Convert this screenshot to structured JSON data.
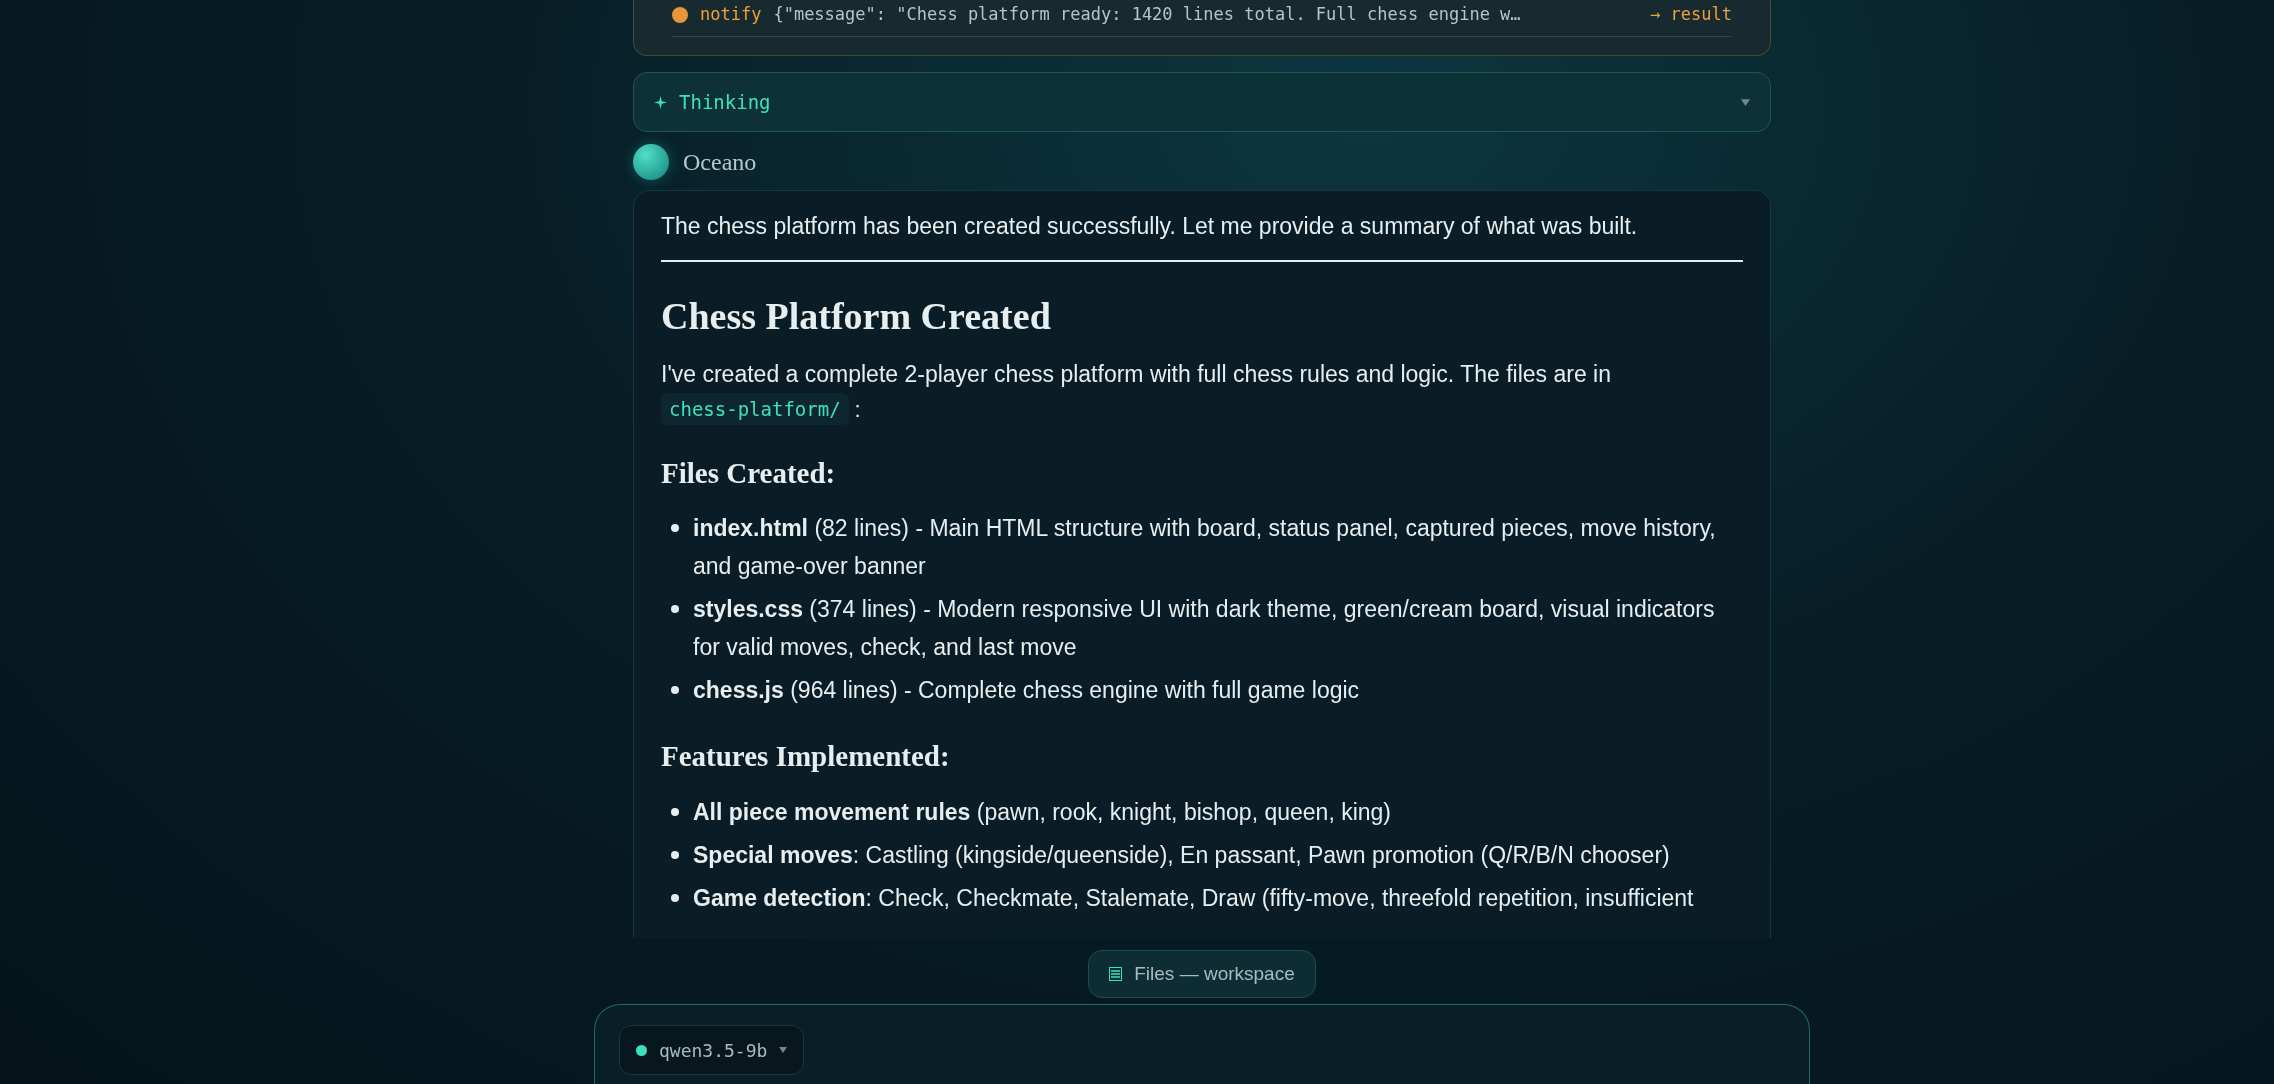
{
  "tool_call": {
    "name": "notify",
    "args": "{\"message\": \"Chess platform ready: 1420 lines total. Full chess engine w…",
    "status": "→ result"
  },
  "thinking": {
    "label": "Thinking",
    "expanded": false
  },
  "assistant": {
    "name": "Oceano"
  },
  "message": {
    "intro": "The chess platform has been created successfully. Let me provide a summary of what was built.",
    "heading": "Chess Platform Created",
    "paragraph": "I've created a complete 2-player chess platform with full chess rules and logic. The files are in",
    "path": "chess-platform/",
    "after_path": ":",
    "sections": [
      {
        "title": "Files Created:",
        "items": [
          "**index.html** (82 lines) - Main HTML structure with board, status panel, captured pieces, move history, and game-over banner",
          "**styles.css** (374 lines) - Modern responsive UI with dark theme, green/cream board, visual indicators for valid moves, check, and last move",
          "**chess.js** (964 lines) - Complete chess engine with full game logic"
        ]
      },
      {
        "title": "Features Implemented:",
        "items": [
          "**All piece movement rules** (pawn, rook, knight, bishop, queen, king)",
          "**Special moves**: Castling (kingside/queenside), En passant, Pawn promotion (Q/R/B/N chooser)",
          "**Game detection**: Check, Checkmate, Stalemate, Draw (fifty-move, threefold repetition, insufficient"
        ]
      }
    ]
  },
  "files_button": {
    "label": "Files — workspace"
  },
  "composer": {
    "model": "qwen3.5-9b"
  }
}
